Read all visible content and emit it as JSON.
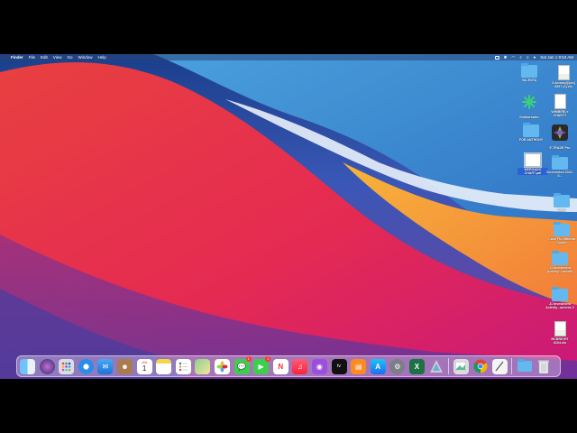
{
  "menubar": {
    "apple": "",
    "app_name": "Finder",
    "items": [
      "File",
      "Edit",
      "View",
      "Go",
      "Window",
      "Help"
    ],
    "clock": "Sat Jan 1  9:53 AM"
  },
  "desktop": {
    "icons": [
      {
        "label": "VALENTA",
        "kind": "folder"
      },
      {
        "label": "3 Ammoy/[ijon] 0897 (4).xls",
        "kind": "xls"
      },
      {
        "label": "thinkorswim",
        "kind": "app"
      },
      {
        "label": "WIMBERLY CHARTT",
        "kind": "doc"
      },
      {
        "label": "FOR ANTHONY",
        "kind": "folder"
      },
      {
        "label": "E-TRADE Pro",
        "kind": "app"
      },
      {
        "label": "MERGADO CHART.pdf",
        "kind": "pdf",
        "selected": true
      },
      {
        "label": "Screenshot 2022-0...",
        "kind": "folder"
      },
      {
        "label": "Cash",
        "kind": "folder"
      },
      {
        "label": "Cash Flo. Mateba Smoth",
        "kind": "folder"
      },
      {
        "label": "J1 Investment Activity...uments",
        "kind": "folder"
      },
      {
        "label": "J1 Investment Activity...uments 2",
        "kind": "folder"
      },
      {
        "label": "MCBRIGHT 8104.xls",
        "kind": "xls"
      }
    ]
  },
  "dock": {
    "calendar_month": "JAN",
    "calendar_day": "1",
    "messages_badge": "1",
    "facetime_badge": "1",
    "colors": {
      "accent": "#2a63d6"
    }
  }
}
